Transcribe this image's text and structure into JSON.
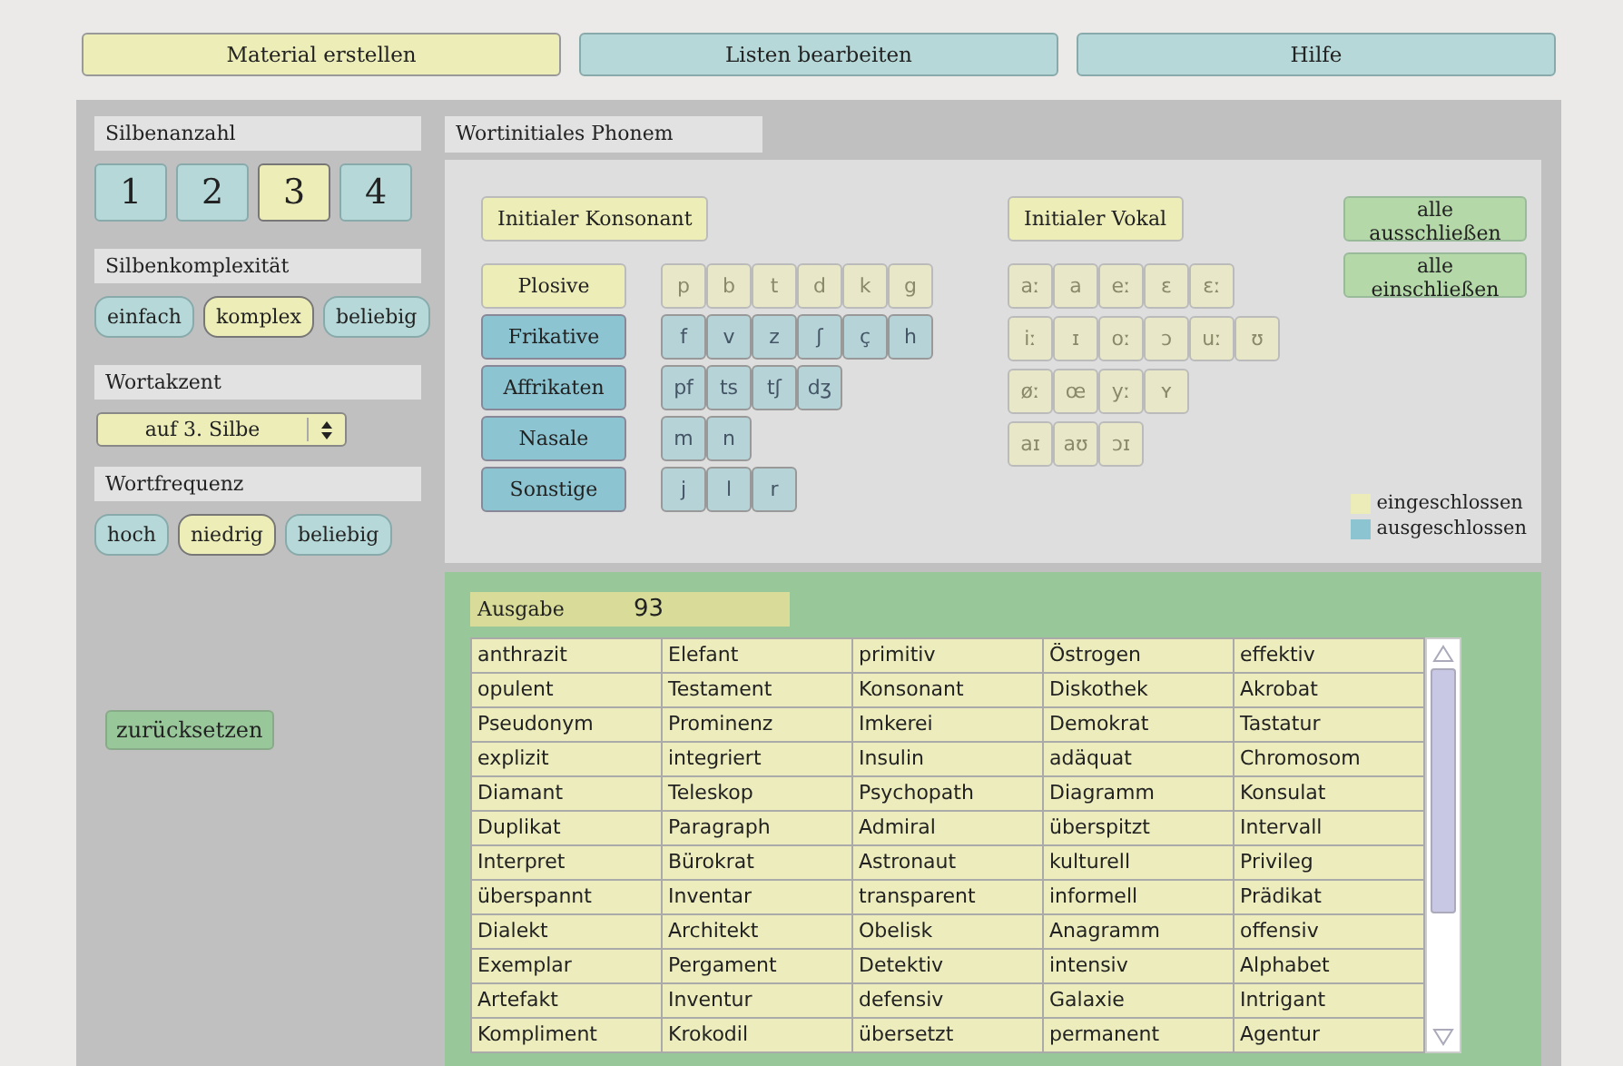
{
  "tabs": [
    {
      "label": "Material erstellen",
      "selected": true
    },
    {
      "label": "Listen bearbeiten",
      "selected": false
    },
    {
      "label": "Hilfe",
      "selected": false
    }
  ],
  "sidebar": {
    "syllable_count": {
      "label": "Silbenanzahl",
      "options": [
        {
          "label": "1",
          "selected": false
        },
        {
          "label": "2",
          "selected": false
        },
        {
          "label": "3",
          "selected": true
        },
        {
          "label": "4",
          "selected": false
        }
      ]
    },
    "syllable_complexity": {
      "label": "Silbenkomplexität",
      "options": [
        {
          "label": "einfach",
          "selected": false
        },
        {
          "label": "komplex",
          "selected": true
        },
        {
          "label": "beliebig",
          "selected": false
        }
      ]
    },
    "word_stress": {
      "label": "Wortakzent",
      "value": "auf 3. Silbe"
    },
    "word_frequency": {
      "label": "Wortfrequenz",
      "options": [
        {
          "label": "hoch",
          "selected": false
        },
        {
          "label": "niedrig",
          "selected": true
        },
        {
          "label": "beliebig",
          "selected": false
        }
      ]
    },
    "reset_button": "zurücksetzen"
  },
  "phoneme_panel": {
    "title": "Wortinitiales Phonem",
    "consonants": {
      "label": "Initialer Konsonant",
      "included": true,
      "categories": [
        {
          "label": "Plosive",
          "included": true,
          "phonemes": [
            {
              "symbol": "p",
              "included": true
            },
            {
              "symbol": "b",
              "included": true
            },
            {
              "symbol": "t",
              "included": true
            },
            {
              "symbol": "d",
              "included": true
            },
            {
              "symbol": "k",
              "included": true
            },
            {
              "symbol": "g",
              "included": true
            }
          ]
        },
        {
          "label": "Frikative",
          "included": false,
          "phonemes": [
            {
              "symbol": "f",
              "included": false
            },
            {
              "symbol": "v",
              "included": false
            },
            {
              "symbol": "z",
              "included": false
            },
            {
              "symbol": "ʃ",
              "included": false
            },
            {
              "symbol": "ç",
              "included": false
            },
            {
              "symbol": "h",
              "included": false
            }
          ]
        },
        {
          "label": "Affrikaten",
          "included": false,
          "phonemes": [
            {
              "symbol": "pf",
              "included": false
            },
            {
              "symbol": "ts",
              "included": false
            },
            {
              "symbol": "tʃ",
              "included": false
            },
            {
              "symbol": "dʒ",
              "included": false
            }
          ]
        },
        {
          "label": "Nasale",
          "included": false,
          "phonemes": [
            {
              "symbol": "m",
              "included": false
            },
            {
              "symbol": "n",
              "included": false
            }
          ]
        },
        {
          "label": "Sonstige",
          "included": false,
          "phonemes": [
            {
              "symbol": "j",
              "included": false
            },
            {
              "symbol": "l",
              "included": false
            },
            {
              "symbol": "r",
              "included": false
            }
          ]
        }
      ]
    },
    "vowels": {
      "label": "Initialer Vokal",
      "included": true,
      "rows": [
        [
          {
            "symbol": "aː",
            "included": true
          },
          {
            "symbol": "a",
            "included": true
          },
          {
            "symbol": "eː",
            "included": true
          },
          {
            "symbol": "ɛ",
            "included": true
          },
          {
            "symbol": "ɛː",
            "included": true
          }
        ],
        [
          {
            "symbol": "iː",
            "included": true
          },
          {
            "symbol": "ɪ",
            "included": true
          },
          {
            "symbol": "oː",
            "included": true
          },
          {
            "symbol": "ɔ",
            "included": true
          },
          {
            "symbol": "uː",
            "included": true
          },
          {
            "symbol": "ʊ",
            "included": true
          }
        ],
        [
          {
            "symbol": "øː",
            "included": true
          },
          {
            "symbol": "œ",
            "included": true
          },
          {
            "symbol": "yː",
            "included": true
          },
          {
            "symbol": "ʏ",
            "included": true
          }
        ],
        [
          {
            "symbol": "aɪ",
            "included": true
          },
          {
            "symbol": "aʊ",
            "included": true
          },
          {
            "symbol": "ɔɪ",
            "included": true
          }
        ]
      ]
    },
    "actions": [
      "alle ausschließen",
      "alle einschließen"
    ],
    "legend": [
      {
        "label": "eingeschlossen",
        "color": "#ececb8"
      },
      {
        "label": "ausgeschlossen",
        "color": "#8cc4d2"
      }
    ]
  },
  "output": {
    "label": "Ausgabe",
    "count": "93",
    "rows": [
      [
        "anthrazit",
        "Elefant",
        "primitiv",
        "Östrogen",
        "effektiv"
      ],
      [
        "opulent",
        "Testament",
        "Konsonant",
        "Diskothek",
        "Akrobat"
      ],
      [
        "Pseudonym",
        "Prominenz",
        "Imkerei",
        "Demokrat",
        "Tastatur"
      ],
      [
        "explizit",
        "integriert",
        "Insulin",
        "adäquat",
        "Chromosom"
      ],
      [
        "Diamant",
        "Teleskop",
        "Psychopath",
        "Diagramm",
        "Konsulat"
      ],
      [
        "Duplikat",
        "Paragraph",
        "Admiral",
        "überspitzt",
        "Intervall"
      ],
      [
        "Interpret",
        "Bürokrat",
        "Astronaut",
        "kulturell",
        "Privileg"
      ],
      [
        "überspannt",
        "Inventar",
        "transparent",
        "informell",
        "Prädikat"
      ],
      [
        "Dialekt",
        "Architekt",
        "Obelisk",
        "Anagramm",
        "offensiv"
      ],
      [
        "Exemplar",
        "Pergament",
        "Detektiv",
        "intensiv",
        "Alphabet"
      ],
      [
        "Artefakt",
        "Inventur",
        "defensiv",
        "Galaxie",
        "Intrigant"
      ],
      [
        "Kompliment",
        "Krokodil",
        "übersetzt",
        "permanent",
        "Agentur"
      ]
    ]
  }
}
